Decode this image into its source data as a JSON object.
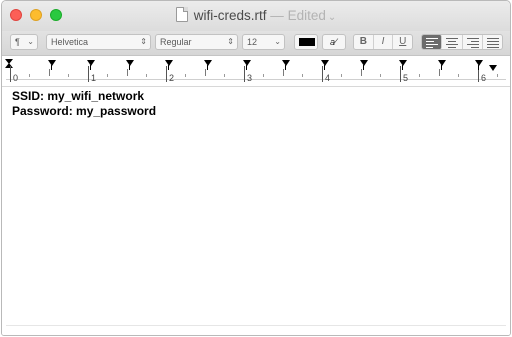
{
  "window": {
    "title": "wifi-creds.rtf",
    "title_separator": "—",
    "status": "Edited",
    "status_chevron": "⌄"
  },
  "toolbar": {
    "paragraph_style": "¶",
    "font_family": "Helvetica",
    "font_typeface": "Regular",
    "font_size": "12",
    "bold_label": "B",
    "italic_label": "I",
    "underline_label": "U",
    "text_color": "#000000",
    "alignment_selected": "left"
  },
  "ruler": {
    "labels": [
      "0",
      "1",
      "2",
      "3",
      "4",
      "5",
      "6"
    ]
  },
  "document": {
    "lines": [
      "SSID: my_wifi_network",
      "Password: my_password"
    ]
  },
  "colors": {
    "close": "#fc5f57",
    "minimize": "#fdbc2e",
    "zoom": "#2ac940",
    "active_alignment": "#6c6c6c"
  }
}
